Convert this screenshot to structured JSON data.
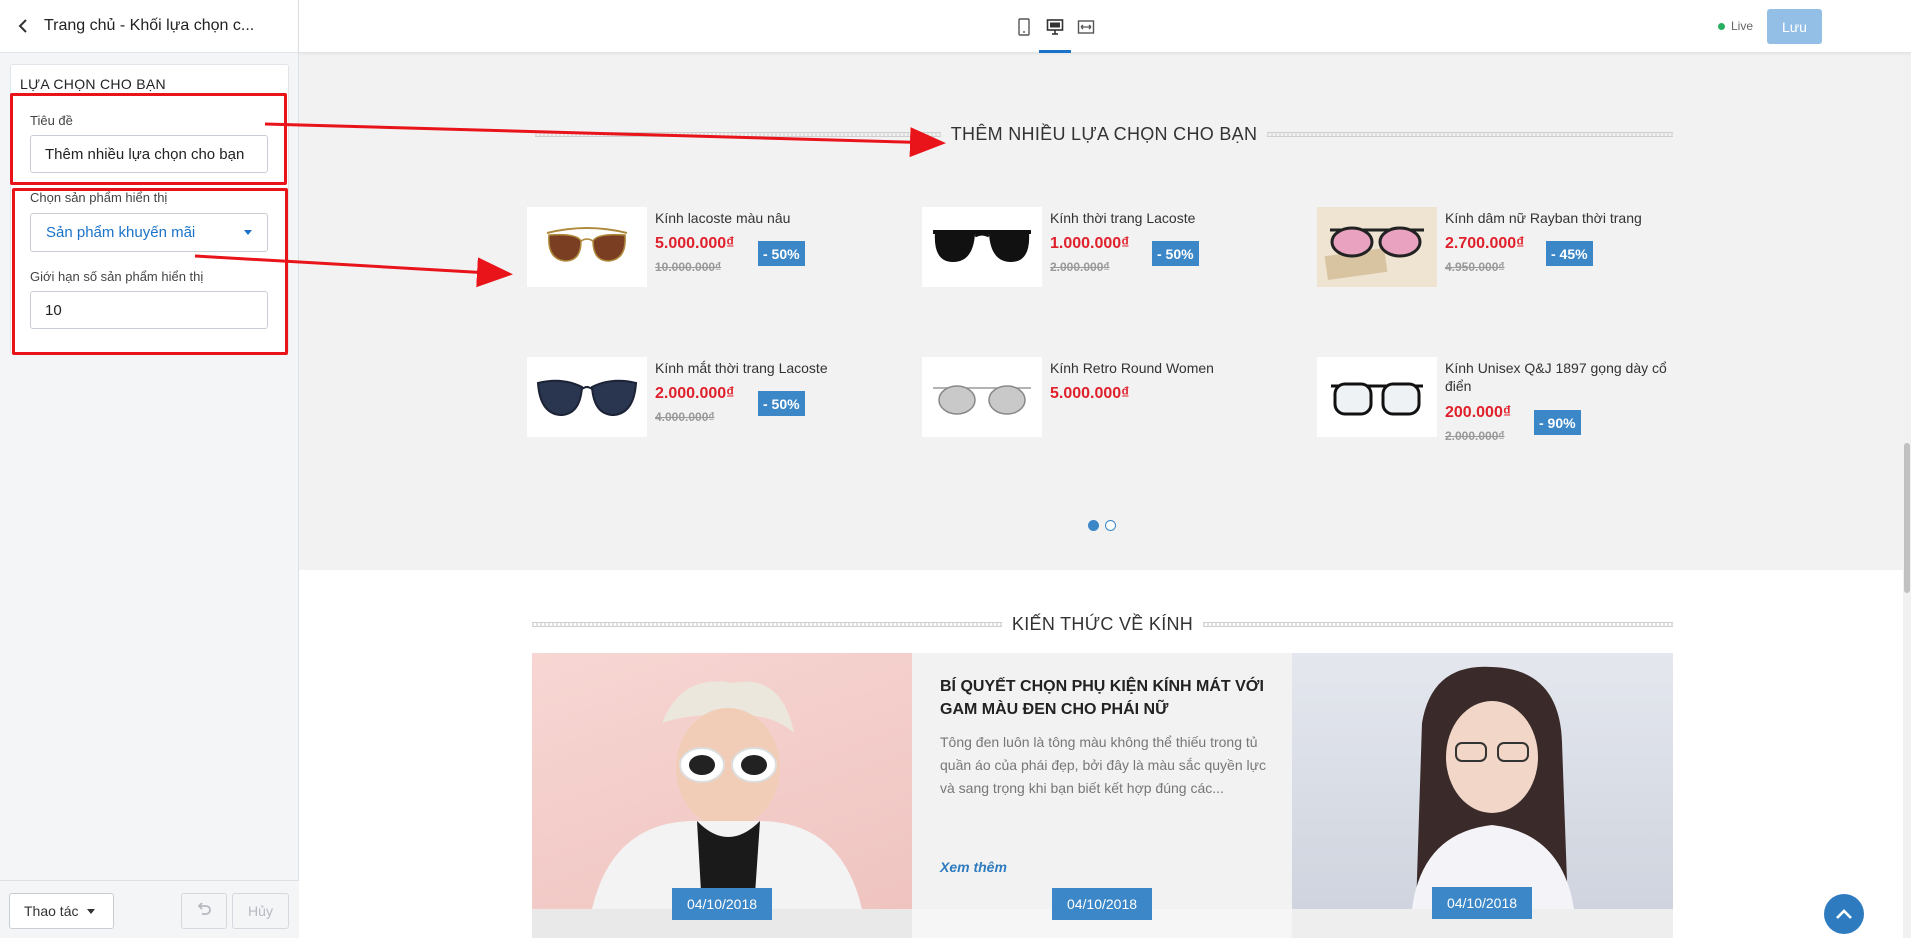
{
  "sidebar": {
    "header_title": "Trang chủ - Khối lựa chọn c...",
    "section_title": "LỰA CHỌN CHO BẠN",
    "title_label": "Tiêu đề",
    "title_value": "Thêm nhiều lựa chọn cho bạn",
    "product_select_label": "Chọn sản phẩm hiển thị",
    "product_select_value": "Sản phẩm khuyến mãi",
    "limit_label": "Giới hạn số sản phẩm hiển thị",
    "limit_value": "10",
    "actions_label": "Thao tác",
    "cancel_label": "Hủy"
  },
  "topbar": {
    "live_label": "Live",
    "save_label": "Lưu",
    "devices": [
      "mobile-icon",
      "desktop-icon",
      "fullwidth-icon"
    ],
    "active_device": "desktop-icon"
  },
  "promo": {
    "title": "THÊM NHIỀU LỰA CHỌN CHO BẠN",
    "products": [
      {
        "name": "Kính lacoste màu nâu",
        "price": "5.000.000₫",
        "old_price": "10.000.000₫",
        "discount": "- 50%"
      },
      {
        "name": "Kính thời trang Lacoste",
        "price": "1.000.000₫",
        "old_price": "2.000.000₫",
        "discount": "- 50%"
      },
      {
        "name": "Kính dâm nữ Rayban thời trang",
        "price": "2.700.000₫",
        "old_price": "4.950.000₫",
        "discount": "- 45%"
      },
      {
        "name": "Kính mắt thời trang Lacoste",
        "price": "2.000.000₫",
        "old_price": "4.000.000₫",
        "discount": "- 50%"
      },
      {
        "name": "Kính Retro Round Women",
        "price": "5.000.000₫"
      },
      {
        "name": "Kính Unisex Q&J 1897 gọng dày cổ điển",
        "price": "200.000₫",
        "old_price": "2.000.000₫",
        "discount": "- 90%"
      }
    ],
    "pages": 2,
    "active_page": 1
  },
  "blog": {
    "title": "KIẾN THỨC VỀ KÍNH",
    "featured": {
      "title": "BÍ QUYẾT CHỌN PHỤ KIỆN KÍNH MÁT VỚI GAM MÀU ĐEN CHO PHÁI NỮ",
      "excerpt": "Tông đen luôn là tông màu không thể thiếu trong tủ quần áo của phái đẹp, bởi đây là màu sắc quyền lực và sang trọng khi bạn biết kết hợp đúng các...",
      "read_more": "Xem thêm"
    },
    "dates": [
      "04/10/2018",
      "04/10/2018",
      "04/10/2018"
    ]
  },
  "colors": {
    "accent": "#3c87c8",
    "price": "#e0202b",
    "annotation": "#e8141a"
  }
}
